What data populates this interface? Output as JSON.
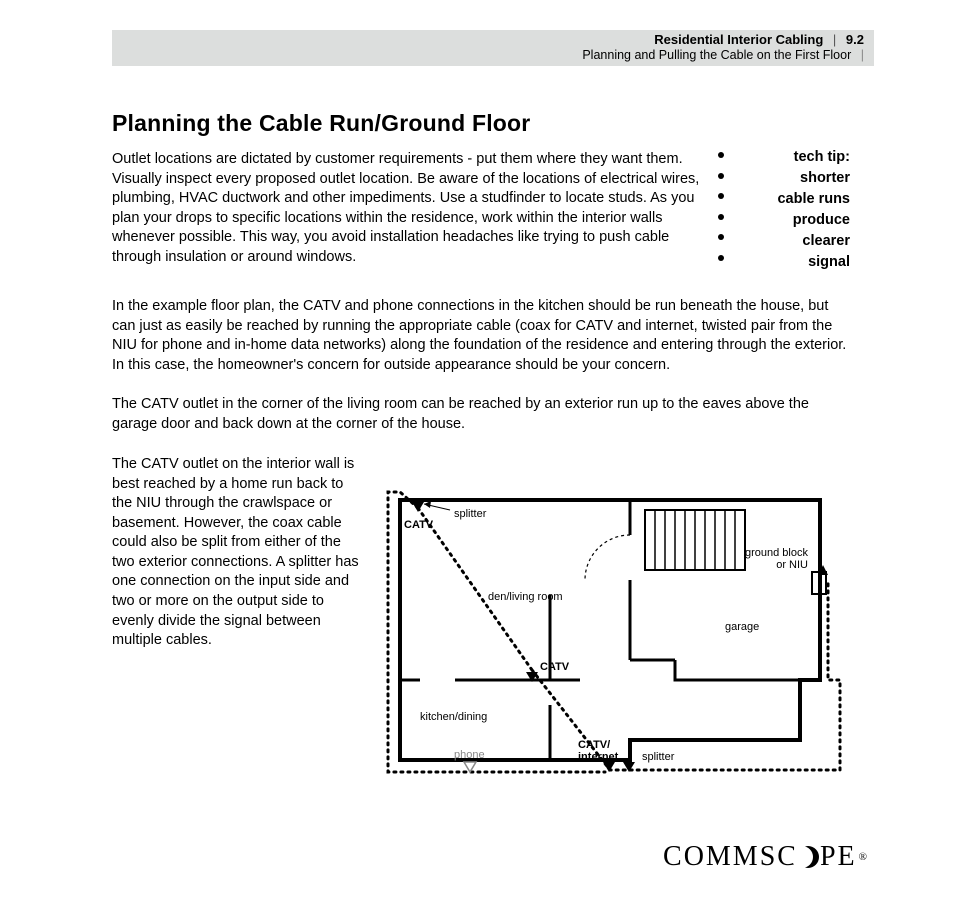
{
  "header": {
    "title": "Residential Interior Cabling",
    "section_number": "9.2",
    "subtitle": "Planning and Pulling the Cable on the First Floor"
  },
  "heading": "Planning the Cable Run/Ground Floor",
  "intro": "Outlet locations are dictated by customer requirements - put them where they want them. Visually inspect every proposed outlet location. Be aware of the locations of electrical wires, plumbing, HVAC ductwork and other impediments. Use a studfinder to locate studs. As you plan your drops to specific locations within the residence, work within the interior walls whenever possible. This way, you avoid installation headaches like trying to push cable through insulation or around windows.",
  "techtip": {
    "l1": "tech tip:",
    "l2": "shorter",
    "l3": "cable runs",
    "l4": "produce",
    "l5": "clearer",
    "l6": "signal"
  },
  "para2": "In the example floor plan, the CATV and phone connections in the kitchen should be run beneath the house, but can just as easily be reached by running the appropriate cable (coax for CATV and internet, twisted pair from the NIU for phone and in-home data networks) along the foundation of the residence and entering through the exterior. In this case, the homeowner's concern for outside appearance should be your concern.",
  "para3": "The CATV outlet in the corner of the living room can be reached by an exterior run up to the eaves above the garage door and back down at the corner of the house.",
  "para4": "The CATV outlet on the interior wall is best reached by a home run back to the NIU through the crawlspace or basement. However, the coax cable could also be split from either of the two exterior connections. A splitter has one connection on the input side and two or more on the output side to evenly divide the signal between multiple cables.",
  "diagram": {
    "labels": {
      "catv_top": "CATV",
      "splitter_top": "splitter",
      "den": "den/living room",
      "ground_block": "ground block or NIU",
      "garage": "garage",
      "catv_mid": "CATV",
      "kitchen": "kitchen/dining",
      "phone": "phone",
      "catv_internet": "CATV/ internet",
      "splitter_bot": "splitter"
    }
  },
  "logo": {
    "pre": "COMMSC",
    "post": "PE",
    "reg": "®"
  }
}
